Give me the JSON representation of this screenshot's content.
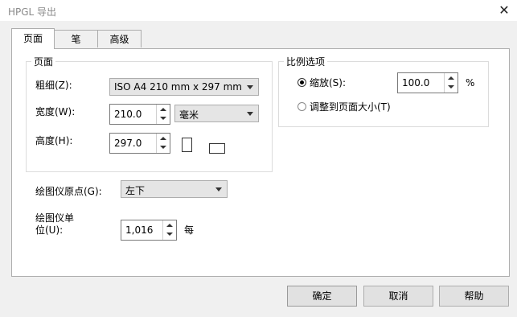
{
  "window": {
    "title": "HPGL 导出",
    "close_glyph": "✕"
  },
  "tabs": [
    {
      "label": "页面",
      "active": true
    },
    {
      "label": "笔",
      "active": false
    },
    {
      "label": "高级",
      "active": false
    }
  ],
  "page_group": {
    "legend": "页面",
    "size_label": "粗细(Z):",
    "size_value": "ISO A4 210 mm x 297 mm",
    "width_label": "宽度(W):",
    "width_value": "210.0",
    "unit_value": "毫米",
    "height_label": "高度(H):",
    "height_value": "297.0",
    "orientation": {
      "portrait_icon": "portrait-icon",
      "landscape_icon": "landscape-icon"
    }
  },
  "scale_group": {
    "legend": "比例选项",
    "scale_label": "缩放(S):",
    "scale_value": "100.0",
    "scale_unit": "%",
    "fit_label": "调整到页面大小(T)",
    "selected": "scale"
  },
  "plotter_origin": {
    "label": "绘图仪原点(G):",
    "value": "左下"
  },
  "plotter_units": {
    "label_line1": "绘图仪单",
    "label_line2": "位(U):",
    "value": "1,016",
    "suffix": "每"
  },
  "buttons": {
    "ok": "确定",
    "cancel": "取消",
    "help": "帮助"
  }
}
